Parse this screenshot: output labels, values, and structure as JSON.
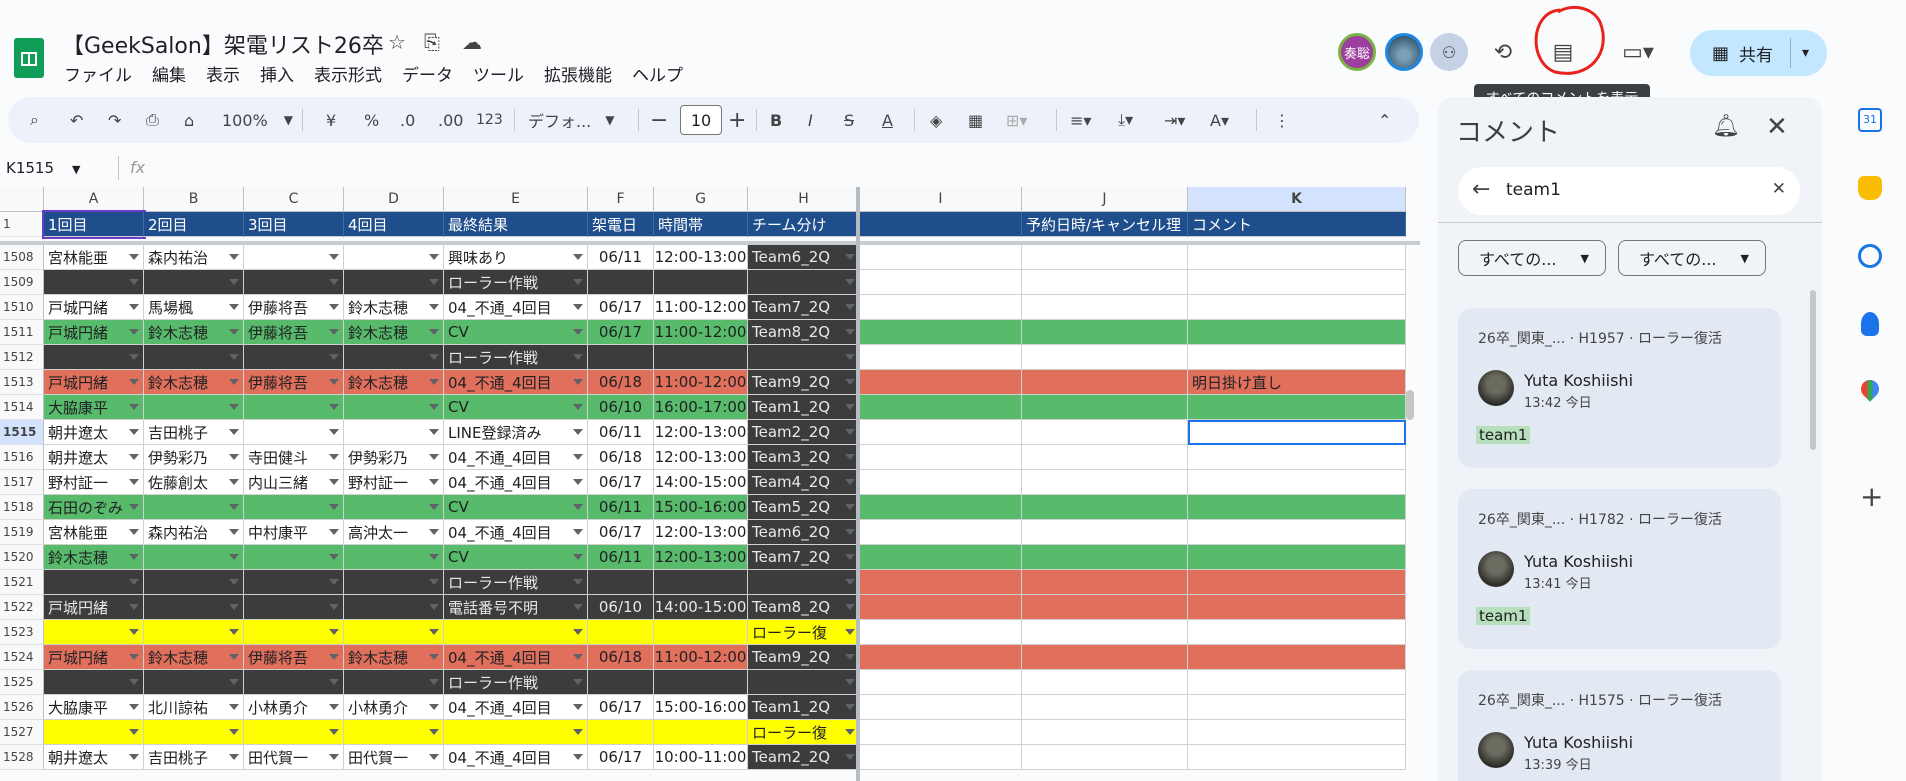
{
  "doc": {
    "title": "【GeekSalon】架電リスト26卒",
    "menu": [
      "ファイル",
      "編集",
      "表示",
      "挿入",
      "表示形式",
      "データ",
      "ツール",
      "拡張機能",
      "ヘルプ"
    ]
  },
  "header": {
    "avatar_label": "奏聡",
    "share_label": "共有",
    "tooltip": "すべてのコメントを表示"
  },
  "toolbar": {
    "zoom": "100%",
    "currency": "¥",
    "percent": "%",
    "dec_dec": ".0",
    "dec_inc": ".00",
    "number_fmt": "123",
    "font": "デフォ...",
    "font_size": "10",
    "bold": "B",
    "italic": "I",
    "strike": "S",
    "text_color": "A"
  },
  "formula": {
    "cell_ref": "K1515",
    "fx": "fx"
  },
  "grid": {
    "columns": [
      "A",
      "B",
      "C",
      "D",
      "E",
      "F",
      "G",
      "H",
      "I",
      "J",
      "K"
    ],
    "header_row": {
      "num": "1",
      "cells": [
        "1回目",
        "2回目",
        "3回目",
        "4回目",
        "最終結果",
        "架電日",
        "時間帯",
        "チーム分け",
        "",
        "予約日時/キャンセル理",
        "コメント"
      ]
    },
    "rows": [
      {
        "num": "1508",
        "c": [
          "宮林能亜",
          "森内祐治",
          "",
          "",
          "興味あり",
          "06/11",
          "12:00-13:00",
          "Team6_2Q",
          "",
          "",
          ""
        ],
        "style": "w"
      },
      {
        "num": "1509",
        "c": [
          "",
          "",
          "",
          "",
          "ローラー作戦",
          "",
          "",
          "",
          "",
          "",
          ""
        ],
        "style": "d"
      },
      {
        "num": "1510",
        "c": [
          "戸城円緒",
          "馬場楓",
          "伊藤将吾",
          "鈴木志穂",
          "04_不通_4回目",
          "06/17",
          "11:00-12:00",
          "Team7_2Q",
          "",
          "",
          ""
        ],
        "style": "w"
      },
      {
        "num": "1511",
        "c": [
          "戸城円緒",
          "鈴木志穂",
          "伊藤将吾",
          "鈴木志穂",
          "CV",
          "06/17",
          "11:00-12:00",
          "Team8_2Q",
          "",
          "",
          ""
        ],
        "style": "g"
      },
      {
        "num": "1512",
        "c": [
          "",
          "",
          "",
          "",
          "ローラー作戦",
          "",
          "",
          "",
          "",
          "",
          ""
        ],
        "style": "d"
      },
      {
        "num": "1513",
        "c": [
          "戸城円緒",
          "鈴木志穂",
          "伊藤将吾",
          "鈴木志穂",
          "04_不通_4回目",
          "06/18",
          "11:00-12:00",
          "Team9_2Q",
          "",
          "",
          "明日掛け直し"
        ],
        "style": "r"
      },
      {
        "num": "1514",
        "c": [
          "大脇康平",
          "",
          "",
          "",
          "CV",
          "06/10",
          "16:00-17:00",
          "Team1_2Q",
          "",
          "",
          ""
        ],
        "style": "g"
      },
      {
        "num": "1515",
        "c": [
          "朝井遼太",
          "吉田桃子",
          "",
          "",
          "LINE登録済み",
          "06/11",
          "12:00-13:00",
          "Team2_2Q",
          "",
          "",
          ""
        ],
        "style": "w"
      },
      {
        "num": "1516",
        "c": [
          "朝井遼太",
          "伊勢彩乃",
          "寺田健斗",
          "伊勢彩乃",
          "04_不通_4回目",
          "06/18",
          "12:00-13:00",
          "Team3_2Q",
          "",
          "",
          ""
        ],
        "style": "w"
      },
      {
        "num": "1517",
        "c": [
          "野村証一",
          "佐藤創太",
          "内山三緒",
          "野村証一",
          "04_不通_4回目",
          "06/17",
          "14:00-15:00",
          "Team4_2Q",
          "",
          "",
          ""
        ],
        "style": "w"
      },
      {
        "num": "1518",
        "c": [
          "石田のぞみ",
          "",
          "",
          "",
          "CV",
          "06/11",
          "15:00-16:00",
          "Team5_2Q",
          "",
          "",
          ""
        ],
        "style": "g"
      },
      {
        "num": "1519",
        "c": [
          "宮林能亜",
          "森内祐治",
          "中村康平",
          "高沖太一",
          "04_不通_4回目",
          "06/17",
          "12:00-13:00",
          "Team6_2Q",
          "",
          "",
          ""
        ],
        "style": "w"
      },
      {
        "num": "1520",
        "c": [
          "鈴木志穂",
          "",
          "",
          "",
          "CV",
          "06/11",
          "12:00-13:00",
          "Team7_2Q",
          "",
          "",
          ""
        ],
        "style": "g"
      },
      {
        "num": "1521",
        "c": [
          "",
          "",
          "",
          "",
          "ローラー作戦",
          "",
          "",
          "",
          "",
          "",
          ""
        ],
        "style": "dr"
      },
      {
        "num": "1522",
        "c": [
          "戸城円緒",
          "",
          "",
          "",
          "電話番号不明",
          "06/10",
          "14:00-15:00",
          "Team8_2Q",
          "",
          "",
          ""
        ],
        "style": "dr"
      },
      {
        "num": "1523",
        "c": [
          "",
          "",
          "",
          "",
          "",
          "",
          "",
          "ローラー復",
          "",
          "",
          ""
        ],
        "style": "y"
      },
      {
        "num": "1524",
        "c": [
          "戸城円緒",
          "鈴木志穂",
          "伊藤将吾",
          "鈴木志穂",
          "04_不通_4回目",
          "06/18",
          "11:00-12:00",
          "Team9_2Q",
          "",
          "",
          ""
        ],
        "style": "r"
      },
      {
        "num": "1525",
        "c": [
          "",
          "",
          "",
          "",
          "ローラー作戦",
          "",
          "",
          "",
          "",
          "",
          ""
        ],
        "style": "d"
      },
      {
        "num": "1526",
        "c": [
          "大脇康平",
          "北川諒祐",
          "小林勇介",
          "小林勇介",
          "04_不通_4回目",
          "06/17",
          "15:00-16:00",
          "Team1_2Q",
          "",
          "",
          ""
        ],
        "style": "w"
      },
      {
        "num": "1527",
        "c": [
          "",
          "",
          "",
          "",
          "",
          "",
          "",
          "ローラー復",
          "",
          "",
          ""
        ],
        "style": "y"
      },
      {
        "num": "1528",
        "c": [
          "朝井遼太",
          "吉田桃子",
          "田代賀一",
          "田代賀一",
          "04_不通_4回目",
          "06/17",
          "10:00-11:00",
          "Team2_2Q",
          "",
          "",
          ""
        ],
        "style": "w"
      }
    ]
  },
  "comments": {
    "title": "コメント",
    "search_value": "team1",
    "filter1": "すべての...",
    "filter2": "すべての...",
    "items": [
      {
        "meta": "26卒_関東_...  · H1957 · ローラー復活",
        "author": "Yuta Koshiishi",
        "time": "13:42 今日",
        "text": "team1"
      },
      {
        "meta": "26卒_関東_...  · H1782 · ローラー復活",
        "author": "Yuta Koshiishi",
        "time": "13:41 今日",
        "text": "team1"
      },
      {
        "meta": "26卒_関東_...  · H1575 · ローラー復活",
        "author": "Yuta Koshiishi",
        "time": "13:39 今日",
        "text": "team1"
      }
    ]
  },
  "colors": {
    "header_blue": "#1f4e8c",
    "green": "#57bb6b",
    "salmon": "#e06f5c",
    "dark": "#3c3c3c",
    "yellow": "#ffff00",
    "annotation_red": "#e8231c"
  }
}
